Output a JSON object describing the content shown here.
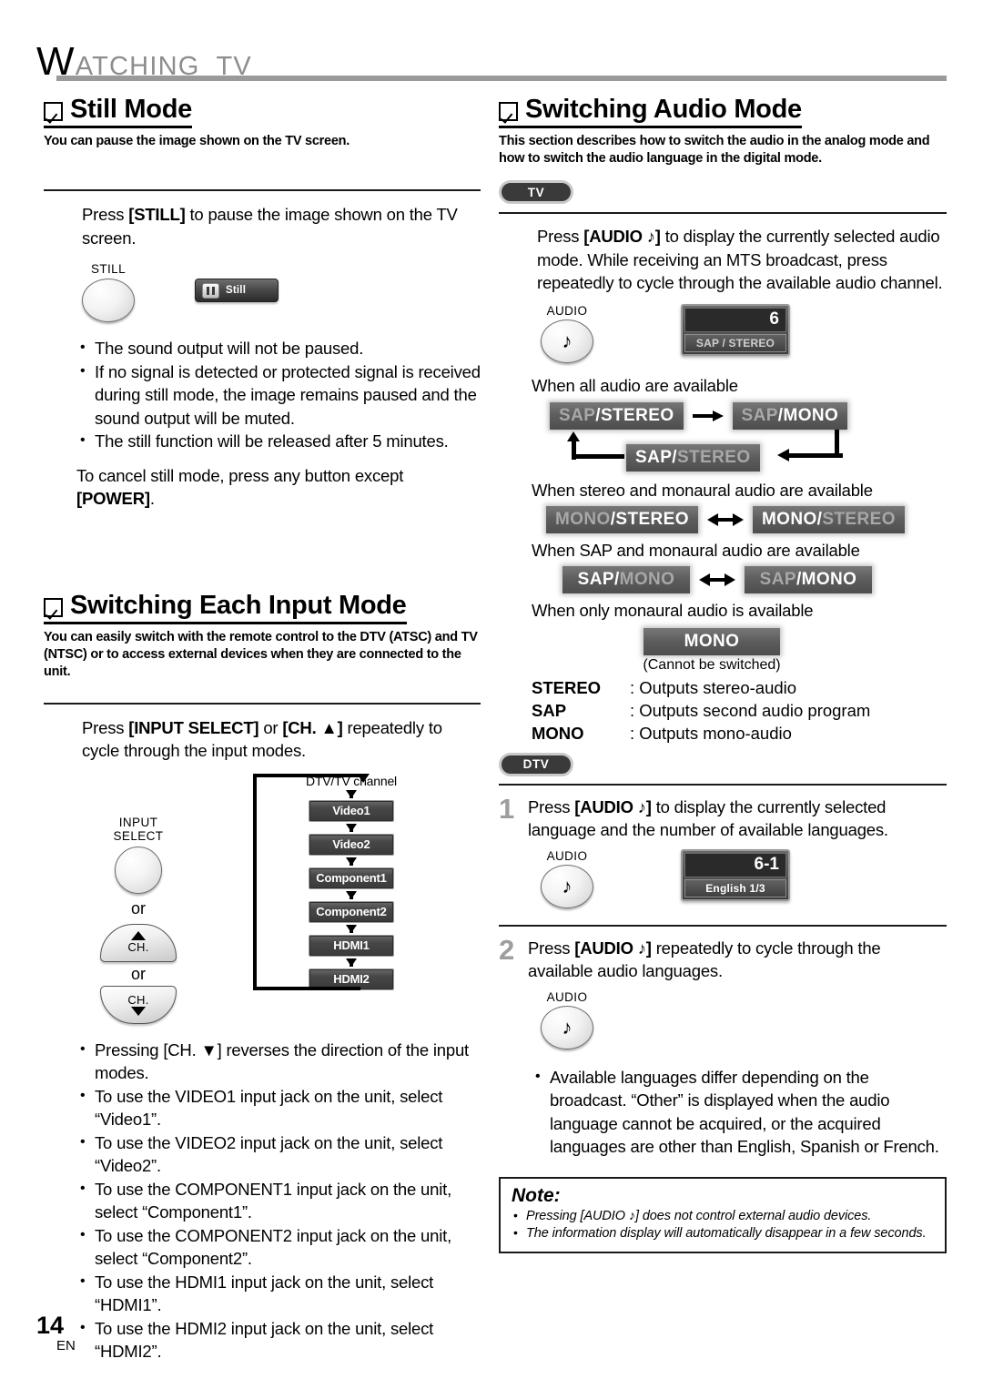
{
  "chapter": {
    "cap": "W",
    "rest": "ATCHING  TV"
  },
  "left": {
    "still": {
      "heading": "Still Mode",
      "subtitle": "You can pause the image shown on the TV screen.",
      "intro_pre": "Press ",
      "intro_key": "[STILL]",
      "intro_post": " to pause the image shown on the TV screen.",
      "key_label": "STILL",
      "osd_button_label": "Still",
      "bullets": [
        "The sound output will not be paused.",
        "If no signal is detected or protected signal is received during still mode, the image remains paused and the sound output will be muted.",
        "The still function will be released after 5 minutes."
      ],
      "cancel_pre": "To cancel still mode, press any button except ",
      "cancel_key": "[POWER]",
      "cancel_post": "."
    },
    "input": {
      "heading": "Switching Each Input Mode",
      "subtitle": "You can easily switch with the remote control to the DTV (ATSC) and TV (NTSC) or to access external devices when they are connected to the unit.",
      "intro_pre": "Press ",
      "intro_key1": "[INPUT SELECT]",
      "intro_mid": " or ",
      "intro_key2": "[CH. ▲]",
      "intro_post": " repeatedly to cycle through the input modes.",
      "key_input_label_line1": "INPUT",
      "key_input_label_line2": "SELECT",
      "or_label": "or",
      "key_ch_label": "CH.",
      "flow_top_label": "DTV/TV channel",
      "flow_items": [
        "Video1",
        "Video2",
        "Component1",
        "Component2",
        "HDMI1",
        "HDMI2"
      ],
      "bullets": [
        "Pressing [CH. ▼] reverses the direction of the input modes.",
        "To use the VIDEO1 input jack on the unit, select “Video1”.",
        "To use the VIDEO2 input jack on the unit, select “Video2”.",
        "To use the COMPONENT1 input jack on the unit, select “Component1”.",
        "To use the COMPONENT2 input jack on the unit, select “Component2”.",
        "To use the HDMI1 input jack on the unit, select “HDMI1”.",
        "To use the HDMI2 input jack on the unit, select “HDMI2”."
      ]
    }
  },
  "right": {
    "audio": {
      "heading": "Switching Audio Mode",
      "subtitle": "This section describes how to switch the audio in the analog mode and how to switch the audio language in the digital mode.",
      "tv_badge": "TV",
      "dtv_badge": "DTV",
      "tv_intro_pre": "Press ",
      "tv_intro_key": "[AUDIO ♪]",
      "tv_intro_post": " to display the currently selected audio mode. While receiving an MTS broadcast, press repeatedly to cycle through the available audio channel.",
      "key_label": "AUDIO",
      "osd_tv_number": "6",
      "osd_tv_sub": "SAP / STEREO",
      "cap_all": "When all audio are available",
      "cycle_all": [
        {
          "left": "SAP",
          "sep": " / ",
          "right": "STEREO",
          "active": "right"
        },
        {
          "left": "SAP",
          "sep": " / ",
          "right": "MONO",
          "active": "right"
        },
        {
          "left": "SAP",
          "sep": " / ",
          "right": "STEREO",
          "active": "left"
        }
      ],
      "cap_stereo_mono": "When stereo and monaural audio are available",
      "pair_stereo_mono": [
        {
          "left": "MONO",
          "sep": " / ",
          "right": "STEREO",
          "active": "right"
        },
        {
          "left": "MONO",
          "sep": " / ",
          "right": "STEREO",
          "active": "left"
        }
      ],
      "cap_sap_mono": "When SAP and monaural audio are available",
      "pair_sap_mono": [
        {
          "left": "SAP",
          "sep": " / ",
          "right": "MONO",
          "active": "left"
        },
        {
          "left": "SAP",
          "sep": " / ",
          "right": "MONO",
          "active": "right"
        }
      ],
      "cap_mono_only": "When only monaural audio is available",
      "mono_box": "MONO",
      "mono_note": "(Cannot be switched)",
      "defs": [
        {
          "key": "STEREO",
          "val": ": Outputs stereo-audio"
        },
        {
          "key": "SAP",
          "val": ": Outputs second audio program"
        },
        {
          "key": "MONO",
          "val": ": Outputs mono-audio"
        }
      ],
      "step1_num": "1",
      "step1_pre": "Press ",
      "step1_key": "[AUDIO ♪]",
      "step1_post": " to display the currently selected language and the number of available languages.",
      "osd_dtv_number": "6-1",
      "osd_dtv_sub": "English 1/3",
      "step2_num": "2",
      "step2_pre": "Press ",
      "step2_key": "[AUDIO ♪]",
      "step2_post": " repeatedly to cycle through the available audio languages.",
      "dtv_bullet": "Available languages differ depending on the broadcast. “Other” is displayed when the audio language cannot be acquired, or the acquired languages are other than English, Spanish or French."
    },
    "note": {
      "title": "Note:",
      "items": [
        "Pressing [AUDIO ♪] does not control external audio devices.",
        "The information display will automatically disappear in a few seconds."
      ]
    }
  },
  "footer": {
    "page": "14",
    "lang": "EN"
  }
}
